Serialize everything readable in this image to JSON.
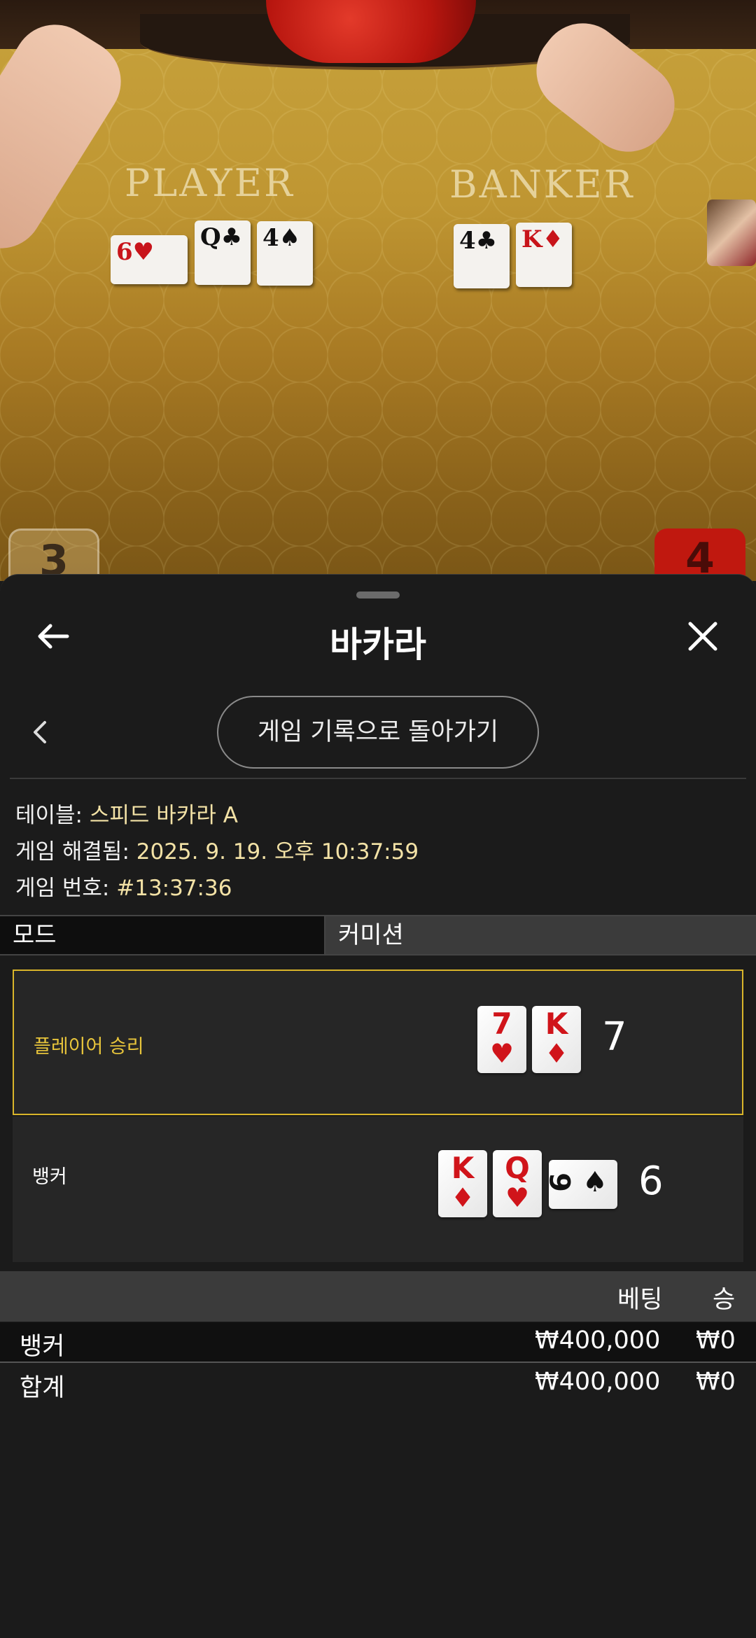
{
  "video": {
    "player_label": "PLAYER",
    "banker_label": "BANKER",
    "player_cards": [
      {
        "rank": "6",
        "suit": "♥",
        "color": "red"
      },
      {
        "rank": "Q",
        "suit": "♣",
        "color": "black"
      },
      {
        "rank": "4",
        "suit": "♠",
        "color": "black"
      }
    ],
    "banker_cards": [
      {
        "rank": "4",
        "suit": "♣",
        "color": "black"
      },
      {
        "rank": "K",
        "suit": "♦",
        "color": "red"
      }
    ],
    "player_score": "3",
    "banker_score": "4"
  },
  "header": {
    "title": "바카라"
  },
  "history_button": "게임 기록으로 돌아가기",
  "info": {
    "table_label": "테이블:",
    "table_value": "스피드 바카라 A",
    "resolved_label": "게임 해결됨:",
    "resolved_value": "2025. 9. 19. 오후 10:37:59",
    "game_no_label": "게임 번호:",
    "game_no_value": "#13:37:36"
  },
  "tabs": {
    "mode": "모드",
    "commission": "커미션"
  },
  "results": {
    "player": {
      "label": "플레이어 승리",
      "score": "7",
      "cards": [
        {
          "rank": "7",
          "suit": "♥",
          "color": "red"
        },
        {
          "rank": "K",
          "suit": "♦",
          "color": "red"
        }
      ]
    },
    "banker": {
      "label": "뱅커",
      "score": "6",
      "cards": [
        {
          "rank": "K",
          "suit": "♦",
          "color": "red"
        },
        {
          "rank": "Q",
          "suit": "♥",
          "color": "red"
        },
        {
          "rank": "6",
          "suit": "♠",
          "color": "black"
        }
      ]
    }
  },
  "bets": {
    "headers": {
      "bet": "베팅",
      "win": "승"
    },
    "rows": [
      {
        "name": "뱅커",
        "bet": "₩400,000",
        "win": "₩0"
      },
      {
        "name": "합계",
        "bet": "₩400,000",
        "win": "₩0"
      }
    ]
  },
  "colors": {
    "accent_gold": "#e7c43b",
    "sheet_bg": "#1b1b1b",
    "card_red": "#d0141a"
  }
}
